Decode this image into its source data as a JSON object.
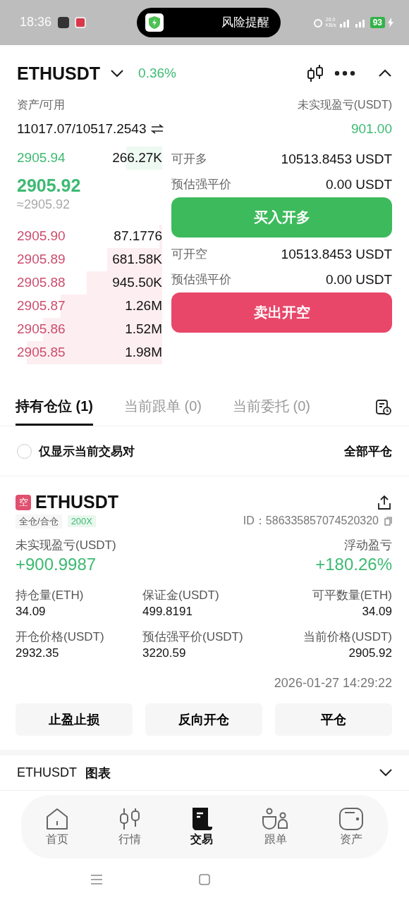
{
  "status_bar": {
    "time": "18:36",
    "alert": "风险提醒",
    "net_speed": "26.0",
    "net_unit": "KB/s",
    "battery": "93"
  },
  "header": {
    "symbol": "ETHUSDT",
    "change": "0.36%"
  },
  "account": {
    "assets_label": "资产/可用",
    "assets_value": "11017.07/10517.2543",
    "pnl_label": "未实现盈亏(USDT)",
    "pnl_value": "901.00"
  },
  "order_book": {
    "bids": [
      {
        "price": "2905.94",
        "amount": "266.27K"
      }
    ],
    "last_price": "2905.92",
    "mark_price": "≈2905.92",
    "asks": [
      {
        "price": "2905.90",
        "amount": "87.1776"
      },
      {
        "price": "2905.89",
        "amount": "681.58K"
      },
      {
        "price": "2905.88",
        "amount": "945.50K"
      },
      {
        "price": "2905.87",
        "amount": "1.26M"
      },
      {
        "price": "2905.86",
        "amount": "1.52M"
      },
      {
        "price": "2905.85",
        "amount": "1.98M"
      }
    ]
  },
  "trade": {
    "long_available_label": "可开多",
    "long_available": "10513.8453 USDT",
    "long_liq_label": "预估强平价",
    "long_liq": "0.00 USDT",
    "buy_button": "买入开多",
    "short_available_label": "可开空",
    "short_available": "10513.8453 USDT",
    "short_liq_label": "预估强平价",
    "short_liq": "0.00 USDT",
    "sell_button": "卖出开空"
  },
  "tabs": [
    {
      "label": "持有仓位 (1)",
      "selected": true
    },
    {
      "label": "当前跟单 (0)",
      "selected": false
    },
    {
      "label": "当前委托 (0)",
      "selected": false
    }
  ],
  "filter": {
    "label": "仅显示当前交易对",
    "checked": false,
    "close_all": "全部平仓"
  },
  "position": {
    "side": "空",
    "symbol": "ETHUSDT",
    "margin_mode": "全仓/合仓",
    "leverage": "200X",
    "id": "ID：586335857074520320",
    "pnl_label": "未实现盈亏(USDT)",
    "pnl": "+900.9987",
    "roe_label": "浮动盈亏",
    "roe": "+180.26%",
    "fields": [
      {
        "label": "持仓量(ETH)",
        "value": "34.09"
      },
      {
        "label": "保证金(USDT)",
        "value": "499.8191"
      },
      {
        "label": "可平数量(ETH)",
        "value": "34.09"
      },
      {
        "label": "开仓价格(USDT)",
        "value": "2932.35"
      },
      {
        "label": "预估强平价(USDT)",
        "value": "3220.59"
      },
      {
        "label": "当前价格(USDT)",
        "value": "2905.92"
      }
    ],
    "time": "2026-01-27 14:29:22",
    "actions": [
      "止盈止损",
      "反向开仓",
      "平仓"
    ]
  },
  "chart_row": {
    "symbol": "ETHUSDT",
    "label": "图表"
  },
  "nav": [
    {
      "label": "首页",
      "selected": false
    },
    {
      "label": "行情",
      "selected": false
    },
    {
      "label": "交易",
      "selected": true
    },
    {
      "label": "跟单",
      "selected": false
    },
    {
      "label": "资产",
      "selected": false
    }
  ]
}
